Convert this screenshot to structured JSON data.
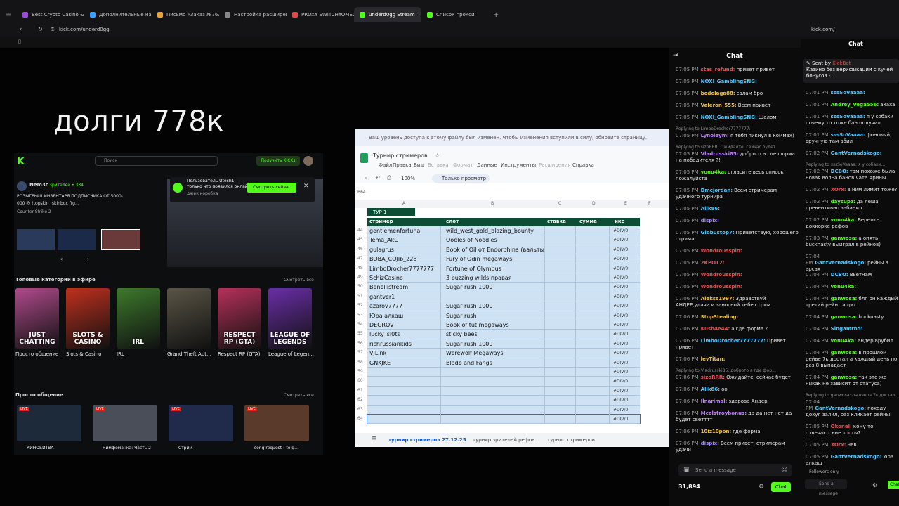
{
  "browser": {
    "tabs": [
      {
        "label": "Best Crypto Casino & Bitco",
        "color": "#9b4ad6"
      },
      {
        "label": "Дополнительные настро",
        "color": "#3aa0ff"
      },
      {
        "label": "Письмо «Заказ №7632…",
        "color": "#e9a33b"
      },
      {
        "label": "Настройка расширения",
        "color": "#888888"
      },
      {
        "label": "PROXY SWITCHYOMEGA",
        "color": "#e04a4a"
      },
      {
        "label": "underd0gg Stream – K",
        "color": "#53fc18"
      },
      {
        "label": "Список прокси",
        "color": "#53fc18"
      }
    ],
    "url": "kick.com/underd0gg",
    "url_right": "kick.com/"
  },
  "stream": {
    "overlay_title": "долги 778к"
  },
  "kick_page": {
    "search_placeholder": "Поиск",
    "get_kicks": "Получить KICKs",
    "streamer_name": "Nem3c",
    "streamer_viewers": "Зрителей • 334",
    "stream_desc": "РОЗЫГРЫШ ИНВЕНТАРЯ ПОДПИСЧИКА ОТ 5000-",
    "stream_desc2": "000 @ !topskin !skinbox ftg…",
    "stream_cat": "Counter-Strike 2",
    "notif_title": "Пользователь Utech1",
    "notif_body": "только что появился онлайн!",
    "notif_sub": "джек коробка",
    "notif_btn": "Смотреть сейчас",
    "section1": "Топовые категории в эфире",
    "see_all": "Смотреть все",
    "categories": [
      {
        "label": "JUST CHATTING",
        "name": "Просто общение",
        "color": "#b04a8c"
      },
      {
        "label": "SLOTS & CASINO",
        "name": "Slots & Casino",
        "color": "#c2301e"
      },
      {
        "label": "IRL",
        "name": "IRL",
        "color": "#3d7a2c"
      },
      {
        "label": "",
        "name": "Grand Theft Aut…",
        "color": "#5a5546"
      },
      {
        "label": "RESPECT RP (GTA)",
        "name": "Respect RP (GTA)",
        "color": "#b7315b"
      },
      {
        "label": "LEAGUE OF LEGENDS",
        "name": "League of Legen…",
        "color": "#6a2ea8"
      }
    ],
    "section2": "Просто общение",
    "thumbs": [
      {
        "title": "КИНОБИТВА",
        "color": "#1c2a3a"
      },
      {
        "title": "Нимфоманка: Часть 2",
        "color": "#4a4e58"
      },
      {
        "title": "Стрим",
        "color": "#202a4a"
      },
      {
        "title": "song request ! to g…",
        "color": "#5a3a2a"
      }
    ]
  },
  "sheet": {
    "banner": "Ваш уровень доступа к этому файлу был изменен. Чтобы изменения вступили в силу, обновите страницу.",
    "title": "Турнир стримеров",
    "menu": [
      "Файл",
      "Правка",
      "Вид",
      "Вставка",
      "Формат",
      "Данные",
      "Инструменты",
      "Расширения",
      "Справка"
    ],
    "zoom": "100%",
    "readonly": "Только просмотр",
    "cell_ref": "B64",
    "col_letters": [
      "A",
      "B",
      "C",
      "D",
      "E",
      "F"
    ],
    "group_tab": "ТУР 1",
    "headers": [
      "стример",
      "слот",
      "ставка",
      "сумма",
      "икс"
    ],
    "rows": [
      {
        "n": "44",
        "streamer": "gentlemenfortuna",
        "slot": "wild_west_gold_blazing_bounty",
        "x": "#DIV/0!"
      },
      {
        "n": "45",
        "streamer": "Tema_AkC",
        "slot": "Oodles of Noodles",
        "x": "#DIV/0!"
      },
      {
        "n": "46",
        "streamer": "gulagrus",
        "slot": "Book of Oil от Endorphina (вальты)",
        "x": "#DIV/0!"
      },
      {
        "n": "47",
        "streamer": "BOBA_COJlb_228",
        "slot": "Fury of Odin megaways",
        "x": "#DIV/0!"
      },
      {
        "n": "48",
        "streamer": "LimboDrocher7777777",
        "slot": "Fortune of Olympus",
        "x": "#DIV/0!"
      },
      {
        "n": "49",
        "streamer": "SchizCasino",
        "slot": "3 buzzing wilds правая",
        "x": "#DIV/0!"
      },
      {
        "n": "50",
        "streamer": "Benellistream",
        "slot": "Sugar rush 1000",
        "x": "#DIV/0!"
      },
      {
        "n": "51",
        "streamer": "gantver1",
        "slot": "",
        "x": "#DIV/0!"
      },
      {
        "n": "52",
        "streamer": "azarov7777",
        "slot": "Sugar rush 1000",
        "x": "#DIV/0!"
      },
      {
        "n": "53",
        "streamer": "Юра алкаш",
        "slot": "Sugar rush",
        "x": "#DIV/0!"
      },
      {
        "n": "54",
        "streamer": "DEGROV",
        "slot": "Book of tut megaways",
        "x": "#DIV/0!"
      },
      {
        "n": "55",
        "streamer": "lucky_sl0ts",
        "slot": "sticky bees",
        "x": "#DIV/0!"
      },
      {
        "n": "56",
        "streamer": "richrussiankids",
        "slot": "Sugar rush 1000",
        "x": "#DIV/0!"
      },
      {
        "n": "57",
        "streamer": "VJLink",
        "slot": "Werewolf Megaways",
        "x": "#DIV/0!"
      },
      {
        "n": "58",
        "streamer": "GNKJKE",
        "slot": "Blade and Fangs",
        "x": "#DIV/0!"
      },
      {
        "n": "59",
        "streamer": "",
        "slot": "",
        "x": "#DIV/0!"
      },
      {
        "n": "60",
        "streamer": "",
        "slot": "",
        "x": "#DIV/0!"
      },
      {
        "n": "61",
        "streamer": "",
        "slot": "",
        "x": "#DIV/0!"
      },
      {
        "n": "62",
        "streamer": "",
        "slot": "",
        "x": "#DIV/0!"
      },
      {
        "n": "63",
        "streamer": "",
        "slot": "",
        "x": "#DIV/0!"
      },
      {
        "n": "64",
        "streamer": "",
        "slot": "",
        "x": "#DIV/0!"
      }
    ],
    "bottom_tabs": [
      "турнир стримеров 27.12.25",
      "турнир зрителей рефов",
      "турнир стримеров"
    ]
  },
  "chat": {
    "title": "Chat",
    "messages": [
      {
        "time": "07:05 PM",
        "user": "stas_refund:",
        "text": "привет привет",
        "color": "#e05050"
      },
      {
        "time": "07:05 PM",
        "user": "NOXI_GamblingSNG:",
        "text": "",
        "color": "#53c7ff"
      },
      {
        "time": "07:05 PM",
        "user": "bedolaga88:",
        "text": "салам бро",
        "color": "#f0c040"
      },
      {
        "time": "07:05 PM",
        "user": "Valeron_555:",
        "text": "Всем привет",
        "color": "#f0c040"
      },
      {
        "time": "07:05 PM",
        "user": "NOXI_GamblingSNG:",
        "text": "Шалом",
        "color": "#53c7ff"
      },
      {
        "time": "07:05 PM",
        "user": "Lynoleym:",
        "text": "я тебя пикнул в коммах)",
        "color": "#c080ff",
        "reply": "Replying to LimboDrocher7777777:"
      },
      {
        "time": "07:05 PM",
        "user": "Vladrusski85:",
        "text": "доброго а где форма на победителя ?!",
        "color": "#c080ff",
        "reply": "Replying to sizoRRR: Ожидайте, сейчас будет"
      },
      {
        "time": "07:05 PM",
        "user": "vonu4ka:",
        "text": "огласите весь список пожалуйста",
        "color": "#53fc18"
      },
      {
        "time": "07:05 PM",
        "user": "Dmcjordan:",
        "text": "Всем стримерам удачного турнира",
        "color": "#53c7ff"
      },
      {
        "time": "07:05 PM",
        "user": "Alik86:",
        "text": "",
        "color": "#53c7ff"
      },
      {
        "time": "07:05 PM",
        "user": "dispix:",
        "text": "",
        "color": "#a080ff"
      },
      {
        "time": "07:05 PM",
        "user": "Globustop7:",
        "text": "Приветствую, хорошего стрима",
        "color": "#53c7ff"
      },
      {
        "time": "07:05 PM",
        "user": "Wondrousspin:",
        "text": "",
        "color": "#e05050"
      },
      {
        "time": "07:05 PM",
        "user": "2KPOT2:",
        "text": "",
        "color": "#e05050"
      },
      {
        "time": "07:05 PM",
        "user": "Wondrousspin:",
        "text": "",
        "color": "#e05050"
      },
      {
        "time": "07:05 PM",
        "user": "Wondrousspin:",
        "text": "",
        "color": "#e05050"
      },
      {
        "time": "07:06 PM",
        "user": "Alekss1997:",
        "text": "Здравствуй АНДЕР,удачи и заносной тебе стрим",
        "color": "#f0c040"
      },
      {
        "time": "07:06 PM",
        "user": "StopStealing:",
        "text": "",
        "color": "#f0c040"
      },
      {
        "time": "07:06 PM",
        "user": "Kush4e44:",
        "text": "а где форма ?",
        "color": "#e05050"
      },
      {
        "time": "07:06 PM",
        "user": "LimboDrocher7777777:",
        "text": "Привет привет",
        "color": "#53c7ff"
      },
      {
        "time": "07:06 PM",
        "user": "levTitan:",
        "text": "",
        "color": "#f0c040"
      },
      {
        "time": "07:06 PM",
        "user": "sizoRRR:",
        "text": "Ожидайте, сейчас будет",
        "color": "#e05050",
        "reply": "Replying to Vladrusski85: доброго а где фор…"
      },
      {
        "time": "07:06 PM",
        "user": "Alik86:",
        "text": "оо",
        "color": "#53c7ff"
      },
      {
        "time": "07:06 PM",
        "user": "Ilnarimal:",
        "text": "здарова Андер",
        "color": "#c080ff"
      },
      {
        "time": "07:06 PM",
        "user": "Mcelstroybonus:",
        "text": "да да нет нет да будет светттт",
        "color": "#c080ff"
      },
      {
        "time": "07:06 PM",
        "user": "10iz10pon:",
        "text": "где форма",
        "color": "#f0c040"
      },
      {
        "time": "07:06 PM",
        "user": "dispix:",
        "text": "Всем привет, стримерам удачи",
        "color": "#a080ff"
      }
    ],
    "input_placeholder": "Send a message",
    "viewers": "31,894",
    "chat_button": "Chat"
  },
  "chat2": {
    "title": "Chat",
    "pinned_by": "Sent by",
    "pinned_user": "KickBet",
    "pinned_text": "Казино без верификации с кучей бонусов -…",
    "messages": [
      {
        "time": "07:01 PM",
        "user": "sssSoVaaaa:",
        "text": "",
        "color": "#53c7ff"
      },
      {
        "time": "07:01 PM",
        "user": "Andrey_Vega556:",
        "text": "ахаха",
        "color": "#53fc18"
      },
      {
        "time": "07:01 PM",
        "user": "sssSoVaaaa:",
        "text": "я у собаки почему то тоже бан получил",
        "color": "#53c7ff"
      },
      {
        "time": "07:01 PM",
        "user": "sssSoVaaaa:",
        "text": "фоновый, вручную там вбил",
        "color": "#53c7ff"
      },
      {
        "time": "07:02 PM",
        "user": "GantVernadskogo:",
        "text": "",
        "color": "#53c7ff"
      },
      {
        "time": "07:02 PM",
        "user": "DCBO:",
        "text": "там похоже была новая волна банов чата Арины",
        "color": "#53c7ff",
        "reply": "Replying to sssSoVaaaa: я у собаки…"
      },
      {
        "time": "07:02 PM",
        "user": "XOrx:",
        "text": "в ним лимит тоже?",
        "color": "#e05050"
      },
      {
        "time": "07:02 PM",
        "user": "daysupz:",
        "text": "да леша превентивно забанил",
        "color": "#53fc18"
      },
      {
        "time": "07:02 PM",
        "user": "vonu4ka:",
        "text": "Верните доккорке рефов",
        "color": "#53fc18"
      },
      {
        "time": "07:03 PM",
        "user": "ganwosa:",
        "text": "а опять bucknasty выиграл в рейнов)",
        "color": "#53fc18"
      },
      {
        "time": "07:04 PM",
        "user": "GantVernadskogo:",
        "text": "рейны в арсах",
        "color": "#53c7ff"
      },
      {
        "time": "07:04 PM",
        "user": "DCBO:",
        "text": "Вьетнам",
        "color": "#53c7ff"
      },
      {
        "time": "07:04 PM",
        "user": "vonu4ka:",
        "text": "",
        "color": "#53fc18"
      },
      {
        "time": "07:04 PM",
        "user": "ganwosa:",
        "text": "бля он каждый третий рейн тащит",
        "color": "#53fc18"
      },
      {
        "time": "07:04 PM",
        "user": "ganwosa:",
        "text": "bucknasty",
        "color": "#53fc18"
      },
      {
        "time": "07:04 PM",
        "user": "Singamrnd:",
        "text": "",
        "color": "#53c7ff"
      },
      {
        "time": "07:04 PM",
        "user": "vonu4ka:",
        "text": "андер врубил",
        "color": "#53fc18"
      },
      {
        "time": "07:04 PM",
        "user": "ganwosa:",
        "text": "в прошлом рейве 7к достал а каждый день по раз 8 выпадает",
        "color": "#53fc18"
      },
      {
        "time": "07:04 PM",
        "user": "ganwosa:",
        "text": "так это же никак не зависит от статуса)",
        "color": "#53fc18"
      },
      {
        "time": "07:04 PM",
        "user": "GantVernadskogo:",
        "text": "походу дохуя залил, раз кликает рейны",
        "color": "#53c7ff",
        "reply": "Replying to ganwosa: он вчера 7к достал…"
      },
      {
        "time": "07:05 PM",
        "user": "Okonel:",
        "text": "кому то отвечают вне хосты?",
        "color": "#e05050"
      },
      {
        "time": "07:05 PM",
        "user": "XOrx:",
        "text": "нев",
        "color": "#e05050"
      },
      {
        "time": "07:05 PM",
        "user": "GantVernadskogo:",
        "text": "юра алкаш",
        "color": "#53c7ff"
      }
    ],
    "followers_only": "Followers only",
    "input_placeholder": "Send a message",
    "chat_button": "Chat"
  }
}
